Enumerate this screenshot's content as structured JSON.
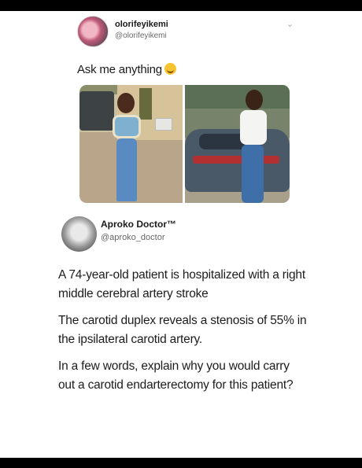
{
  "tweet1": {
    "name": "olorifeyikemi",
    "handle": "@olorifeyikemi",
    "text": "Ask me anything",
    "emoji": "smiling-face-emoji"
  },
  "tweet2": {
    "name": "Aproko Doctor™",
    "handle": "@aproko_doctor",
    "paragraphs": [
      "A 74-year-old patient is hospitalized with a right middle cerebral artery stroke",
      "The carotid duplex reveals a stenosis of 55% in the ipsilateral carotid artery.",
      "In a few words, explain why you would carry out a carotid endarterectomy for this patient?"
    ]
  }
}
